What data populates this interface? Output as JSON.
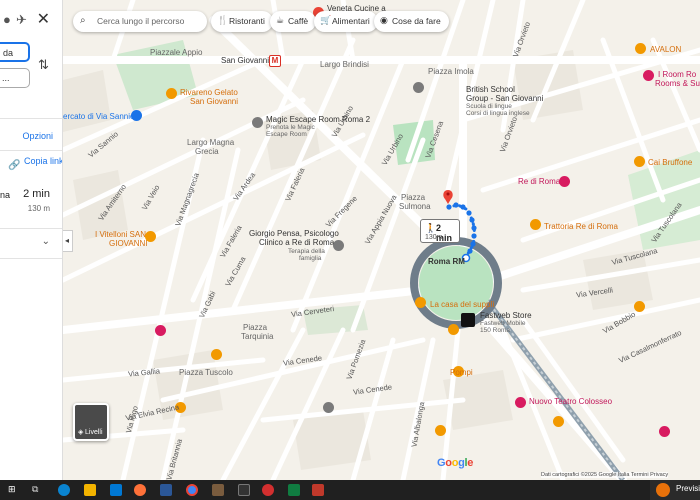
{
  "panel": {
    "mode_icons": [
      "car-icon",
      "transit-icon",
      "walk-icon",
      "flight-icon"
    ],
    "close_label": "✕",
    "from_value": "da",
    "to_value": "...",
    "options_label": "Opzioni",
    "copy_link_label": "Copia link",
    "route": {
      "name": "lana",
      "time": "2 min",
      "distance": "130 m"
    },
    "expand_label": "⌄",
    "collapse_label": "◂"
  },
  "search": {
    "placeholder": "Cerca lungo il percorso",
    "icon": "search-icon"
  },
  "chips": [
    {
      "label": "Ristoranti",
      "icon": "restaurant-icon"
    },
    {
      "label": "Caffè",
      "icon": "cafe-icon"
    },
    {
      "label": "Alimentari",
      "icon": "cart-icon"
    },
    {
      "label": "Cose da fare",
      "icon": "camera-icon"
    }
  ],
  "callout": {
    "time": "2 min",
    "distance": "130m",
    "icon": "walk-icon"
  },
  "layers_label": "Livelli",
  "google_logo": "Google",
  "attribution": "Dati cartografici ©2025 Google   Italia   Termini   Privacy",
  "labels": {
    "top_clip": "Veneta Cucine a",
    "piazzale_appio": "Piazzale Appio",
    "san_giovanni": "San Giovanni",
    "largo_brindisi": "Largo Brindisi",
    "piazza_imola": "Piazza Imola",
    "british_school": "British School",
    "british_school_2": "Group - San Giovanni",
    "british_school_3": "Scuola di lingue",
    "british_school_4": "Corsi di lingua inglese",
    "avalon": "AVALON",
    "room_rooms": "I Room Ro",
    "room_rooms_2": "Rooms & Suit",
    "rivareno": "Rivareno Gelato",
    "rivareno_2": "San Giovanni",
    "mercato": "ercato di Via Sannio",
    "magic_escape": "Magic Escape Room Roma 2",
    "magic_escape_2": "Prenota le Magic",
    "magic_escape_3": "Escape Room",
    "largo_magna": "Largo Magna",
    "largo_magna_2": "Grecia",
    "cai_bruffone": "Cai Bruffone",
    "re_di_roma": "Re di Roma",
    "piazza_sulmona": "Piazza",
    "piazza_sulmona_2": "Sulmona",
    "vitelloni": "I Vitelloni SAN",
    "vitelloni_2": "GIOVANNI",
    "giorgio": "Giorgio Pensa, Psicologo",
    "giorgio_2": "Clinico a Re di Roma",
    "terapia": "Terapia della",
    "terapia_2": "famiglia",
    "trattoria": "Trattoria Re di Roma",
    "roma_rm": "Roma RM",
    "casa_supplì": "La casa del supplì",
    "fastweb": "Fastweb Store",
    "fastweb_2": "Fastweb Mobile",
    "fastweb_3": "150 Roma",
    "piazza_tarquinia": "Piazza",
    "piazza_tarquinia_2": "Tarquinia",
    "pompi": "Pompi",
    "piazza_tuscolo": "Piazza Tuscolo",
    "nuovo_teatro": "Nuovo Teatro Colosseo"
  },
  "streets": {
    "via_sannio": "Via Sannio",
    "via_amiterno": "Via Amiterno",
    "via_veio": "Via Veio",
    "via_magnagrecia": "Via Magnagrecia",
    "via_faleria": "Via Faleria",
    "via_ardea": "Via Ardea",
    "via_urbino": "Via Urbino",
    "via_cesena": "Via Cesena",
    "via_appia_nuova": "Via Appia Nuova",
    "via_fregene": "Via Fregene",
    "via_cerveteri": "Via Cerveteri",
    "via_gallia": "Via Gallia",
    "via_britannia": "Via Britannia",
    "via_pigo": "Via Pigo",
    "via_elvia_recina": "Via Elvia Recina",
    "via_cenede": "Via Cenede",
    "via_pomezia": "Via Pomezia",
    "via_albalonga": "Via Albalonga",
    "via_tuscolana": "Via Tuscolana",
    "via_vercelli": "Via Vercelli",
    "via_bobbio": "Via Bobbio",
    "via_casalmonferrato": "Via Casalmonferrato",
    "via_gabi": "Via Gabi",
    "via_cuma": "Via Cuma",
    "via_orvieto": "Via Orvieto",
    "via_orvieto_2": "Via Orvieto",
    "via_tuscolana_2": "Via Tuscolana"
  },
  "colors": {
    "route": "#1a73e8",
    "roundabout": "#6f7d8a",
    "park": "#b9e3c0",
    "road": "#ffffff",
    "block": "#f4f1ea",
    "major_road": "#ffffff"
  },
  "taskbar_weather": "Previsione"
}
